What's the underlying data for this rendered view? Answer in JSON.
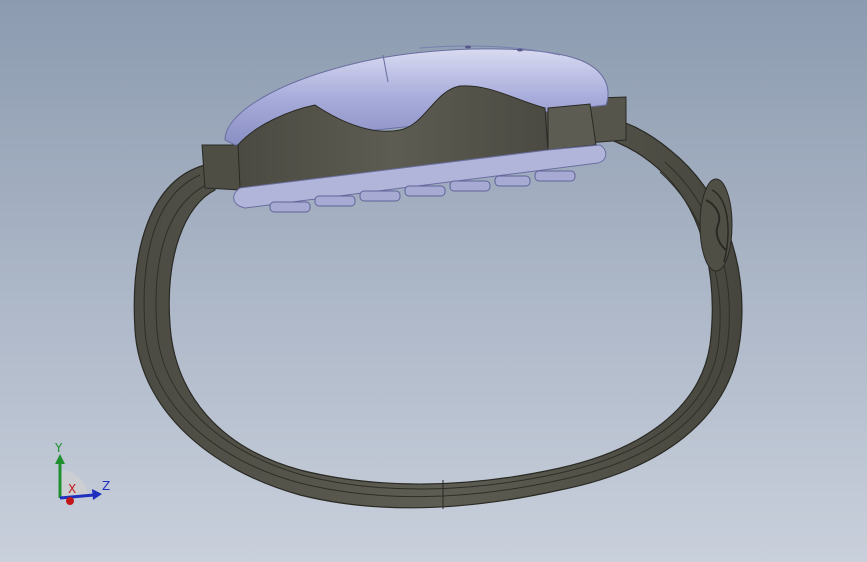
{
  "triad": {
    "y_label": "Y",
    "z_label": "Z",
    "x_label": "X"
  },
  "colors": {
    "background_top": "#8c9bb0",
    "background_bottom": "#c9d0dc",
    "band": "#57574d",
    "body_shell": "#b4b8d8",
    "axis_y": "#1f8f2f",
    "axis_z": "#1f2fbf",
    "axis_x": "#c01818"
  }
}
